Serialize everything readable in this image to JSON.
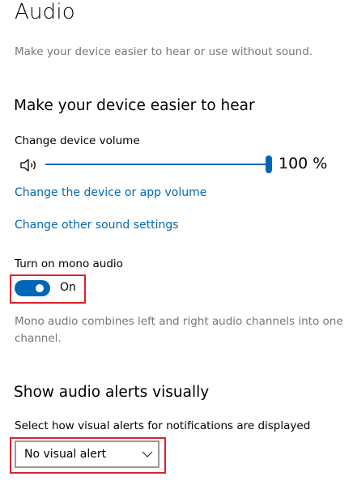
{
  "page": {
    "title": "Audio",
    "subtitle": "Make your device easier to hear or use without sound."
  },
  "hear_section": {
    "heading": "Make your device easier to hear",
    "volume_label": "Change device volume",
    "volume_value": 100,
    "volume_display": "100 %",
    "link_app_volume": "Change the device or app volume",
    "link_other_sound": "Change other sound settings",
    "mono_label": "Turn on mono audio",
    "mono_state": "On",
    "mono_description": "Mono audio combines left and right audio channels into one channel."
  },
  "alerts_section": {
    "heading": "Show audio alerts visually",
    "select_label": "Select how visual alerts for notifications are displayed",
    "select_value": "No visual alert"
  },
  "icons": {
    "speaker": "speaker-icon",
    "chevron": "chevron-down-icon"
  },
  "colors": {
    "accent": "#0067b8",
    "highlight_box": "#d9232e",
    "secondary_text": "#767676"
  }
}
